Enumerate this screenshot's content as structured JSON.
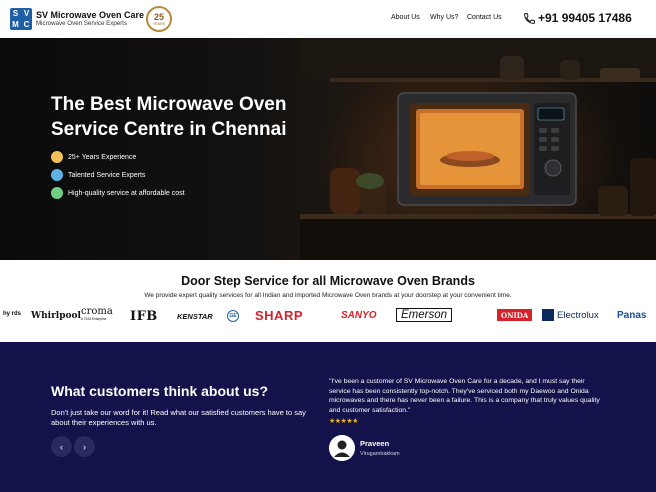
{
  "header": {
    "logo_letters": [
      "S",
      "V",
      "M",
      "C"
    ],
    "brand_name": "SV Microwave Oven Care",
    "brand_sub": "Microwave Oven Service Experts",
    "badge_number": "25",
    "badge_label": "YEARS",
    "nav": {
      "about": "About Us",
      "why": "Why Us?",
      "contact": "Contact Us"
    },
    "phone": "+91 99405 17486"
  },
  "hero": {
    "title": "The Best Microwave Oven Service Centre in Chennai",
    "features": [
      {
        "text": "25+ Years Experience",
        "icon": "experience-icon",
        "color": "#f3c05a"
      },
      {
        "text": "Talented Service Experts",
        "icon": "expert-icon",
        "color": "#5fb2e6"
      },
      {
        "text": "High-quality service at affordable cost",
        "icon": "quality-icon",
        "color": "#6fcf86"
      }
    ]
  },
  "brands": {
    "title": "Door Step Service for all Microwave Oven Brands",
    "subtitle": "We provide expert quality services for all Indian and imported Microwave Oven brands at your doorstep at your convenient time.",
    "logos": [
      {
        "name": "hy rds",
        "color": "#111111"
      },
      {
        "name": "Whirlpool",
        "color": "#111111"
      },
      {
        "name": "croma",
        "tagline": "A TATA Enterprise",
        "color": "#111111"
      },
      {
        "name": "IFB",
        "color": "#111111"
      },
      {
        "name": "KENSTAR",
        "color": "#111111"
      },
      {
        "name": "GE",
        "color": "#1f5fa8"
      },
      {
        "name": "SHARP",
        "color": "#d6212a"
      },
      {
        "name": "SANYO",
        "color": "#d6212a"
      },
      {
        "name": "Emerson",
        "color": "#111111"
      },
      {
        "name": "ONIDA",
        "color": "#ffffff"
      },
      {
        "name": "Electrolux",
        "color": "#0b2a5b"
      },
      {
        "name": "Panas",
        "color": "#1a4fa0"
      }
    ]
  },
  "testimonials": {
    "title": "What customers think about us?",
    "description": "Don't just take our word for it! Read what our satisfied customers have to say about their experiences with us.",
    "prev": "‹",
    "next": "›",
    "quote": "\"I've been a customer of SV Microwave Oven Care for a decade, and I must say their service has been consistently top-notch. They've serviced both my Daewoo and Onida microwaves and there has never been a failure. This is a company that truly values quality and customer satisfaction.\"",
    "rating": 5,
    "stars": "★★★★★",
    "reviewer": "Praveen",
    "location": "Virugambakkam"
  },
  "colors": {
    "testimonial_bg": "#13124a",
    "star": "#f2b51c",
    "logo_blue": "#1f5fa8"
  }
}
